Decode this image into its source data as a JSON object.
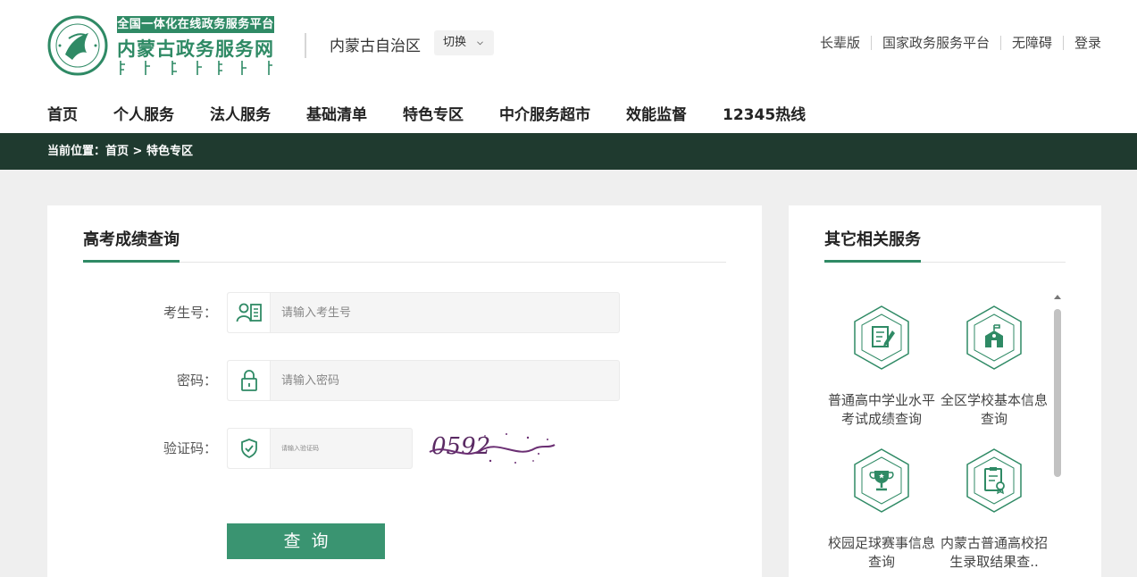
{
  "header": {
    "logo_tag": "全国一体化在线政务服务平台",
    "logo_title": "内蒙古政务服务网",
    "region": "内蒙古自治区",
    "switch_label": "切换",
    "top_links": [
      "长辈版",
      "国家政务服务平台",
      "无障碍",
      "登录"
    ]
  },
  "nav": [
    "首页",
    "个人服务",
    "法人服务",
    "基础清单",
    "特色专区",
    "中介服务超市",
    "效能监督",
    "12345热线"
  ],
  "breadcrumb": {
    "prefix": "当前位置：",
    "home": "首页",
    "separator": " > ",
    "current": "特色专区"
  },
  "query_form": {
    "title": "高考成绩查询",
    "exam_no_label": "考生号：",
    "exam_no_placeholder": "请输入考生号",
    "password_label": "密码：",
    "password_placeholder": "请输入密码",
    "captcha_label": "验证码：",
    "captcha_placeholder": "请输入验证码",
    "captcha_text": "0592",
    "submit_label": "查询"
  },
  "related": {
    "title": "其它相关服务",
    "items": [
      {
        "label": "普通高中学业水平考试成绩查询",
        "icon": "document-edit-icon"
      },
      {
        "label": "全区学校基本信息查询",
        "icon": "school-building-icon"
      },
      {
        "label": "校园足球赛事信息查询",
        "icon": "trophy-icon"
      },
      {
        "label": "内蒙古普通高校招生录取结果查..",
        "icon": "admission-certificate-icon"
      }
    ]
  },
  "colors": {
    "accent": "#2f8a65",
    "button": "#3a9471",
    "breadcrumb_bg": "#1f3a2f",
    "page_bg": "#efefef"
  }
}
